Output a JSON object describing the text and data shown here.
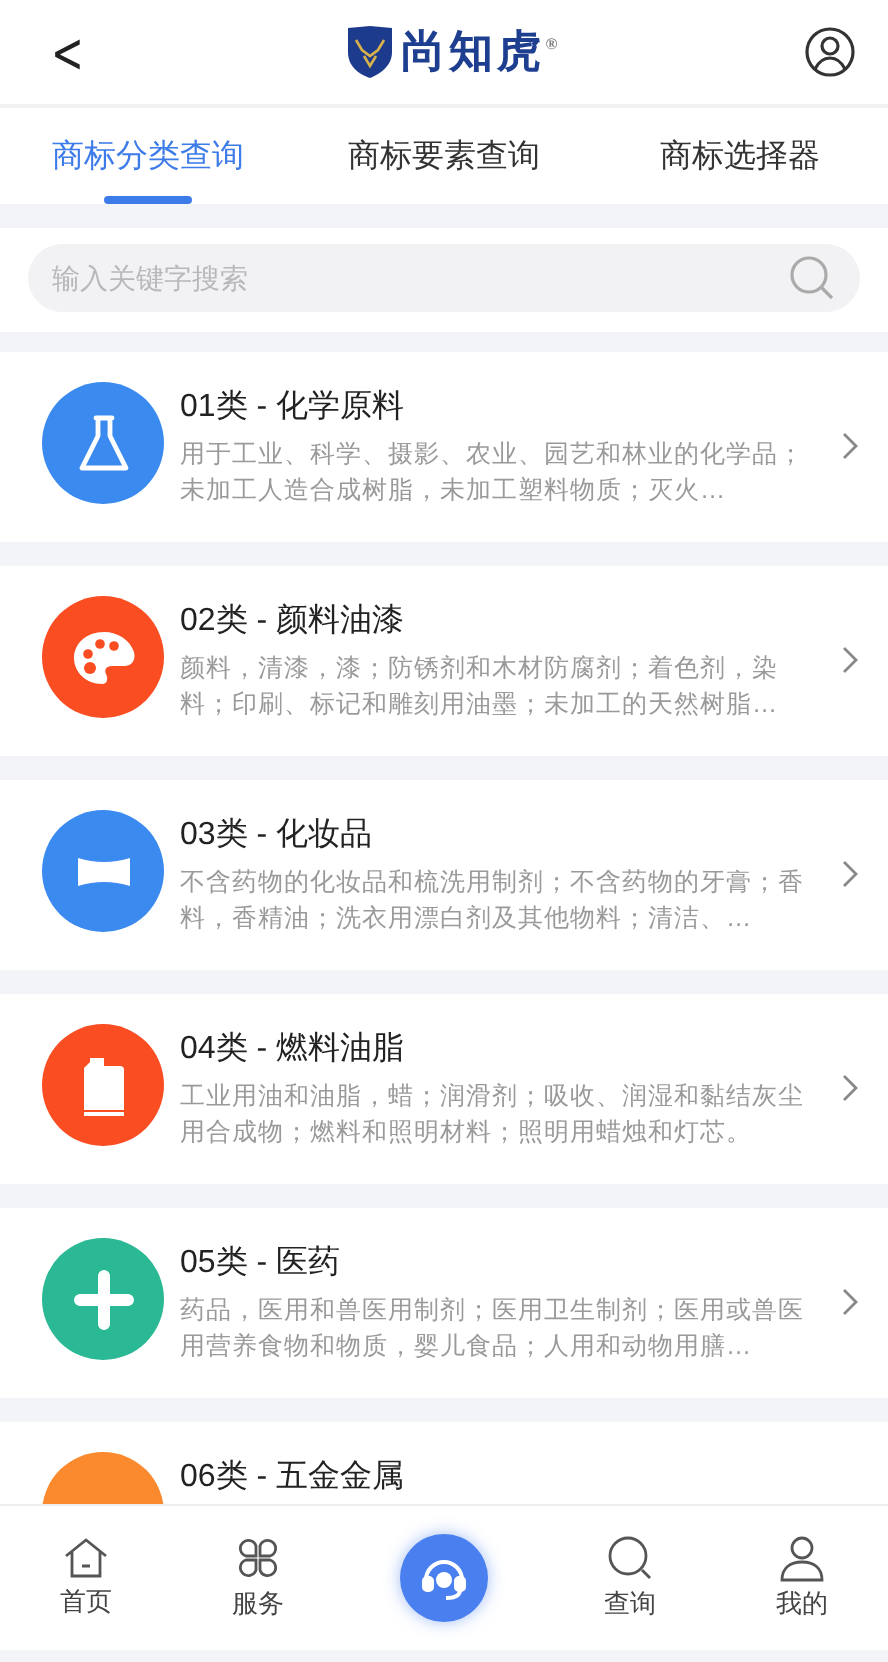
{
  "header": {
    "back": "<",
    "brand": "尚知虎$^{®}$"
  },
  "tabs": [
    {
      "label": "商标分类查询",
      "selected": true
    },
    {
      "label": "商标要素查询",
      "selected": false
    },
    {
      "label": "商标选择器",
      "selected": false
    }
  ],
  "search": {
    "placeholder": "输入关键字搜索"
  },
  "classes": [
    {
      "title": "01类 - 化学原料",
      "description": "用于工业、科学、摄影、农业、园艺和林业的化学品；未加工人造合成树脂，未加工塑料物质；灭火…",
      "color": "#3a8af0"
    },
    {
      "title": "02类 - 颜料油漆",
      "description": "颜料，清漆，漆；防锈剂和木材防腐剂；着色剂，染料；印刷、标记和雕刻用油墨；未加工的天然树脂…",
      "color": "#fa4d22"
    },
    {
      "title": "03类 - 化妆品",
      "description": "不含药物的化妆品和梳洗用制剂；不含药物的牙膏；香料，香精油；洗衣用漂白剂及其他物料；清洁、…",
      "color": "#3a8af0"
    },
    {
      "title": "04类 - 燃料油脂",
      "description": "工业用油和油脂，蜡；润滑剂；吸收、润湿和黏结灰尘用合成物；燃料和照明材料；照明用蜡烛和灯芯。",
      "color": "#fa4d22"
    },
    {
      "title": "05类 - 医药",
      "description": "药品，医用和兽医用制剂；医用卫生制剂；医用或兽医用营养食物和物质，婴儿食品；人用和动物用膳…",
      "color": "#2bb894"
    },
    {
      "title": "06类 - 五金金属",
      "color": "#fb8a2e"
    }
  ],
  "bottom_nav": [
    {
      "kind": "tab",
      "label": "首页"
    },
    {
      "kind": "tab",
      "label": "服务"
    },
    {
      "kind": "center"
    },
    {
      "kind": "tab",
      "label": "查询"
    },
    {
      "kind": "tab",
      "label": "我的"
    }
  ]
}
